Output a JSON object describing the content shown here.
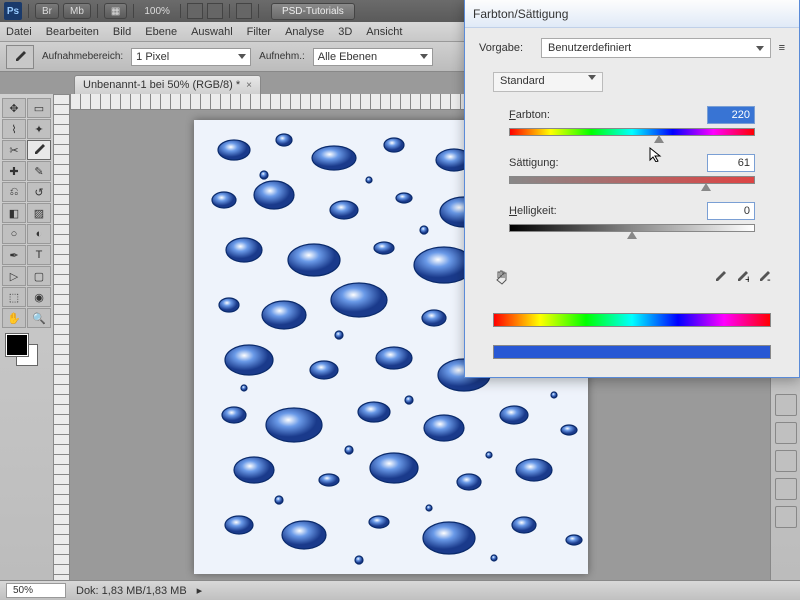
{
  "app": {
    "logo": "Ps",
    "br": "Br",
    "mb": "Mb",
    "zoom": "100%",
    "tutorials": "PSD-Tutorials"
  },
  "menu": [
    "Datei",
    "Bearbeiten",
    "Bild",
    "Ebene",
    "Auswahl",
    "Filter",
    "Analyse",
    "3D",
    "Ansicht"
  ],
  "options": {
    "aufnahme_label": "Aufnahmebereich:",
    "aufnahme_val": "1 Pixel",
    "aufnahme2_label": "Aufnehm.:",
    "aufnahme2_val": "Alle Ebenen"
  },
  "doc": {
    "tab": "Unbenannt-1 bei 50% (RGB/8) *"
  },
  "status": {
    "zoom": "50%",
    "dok": "Dok: 1,83 MB/1,83 MB"
  },
  "dialog": {
    "title": "Farbton/Sättigung",
    "vorgabe_label": "Vorgabe:",
    "vorgabe_val": "Benutzerdefiniert",
    "standard": "Standard",
    "farbton_label": "Farbton:",
    "farbton_val": "220",
    "saettigung_label": "Sättigung:",
    "saettigung_val": "61",
    "helligkeit_label": "Helligkeit:",
    "helligkeit_val": "0"
  }
}
